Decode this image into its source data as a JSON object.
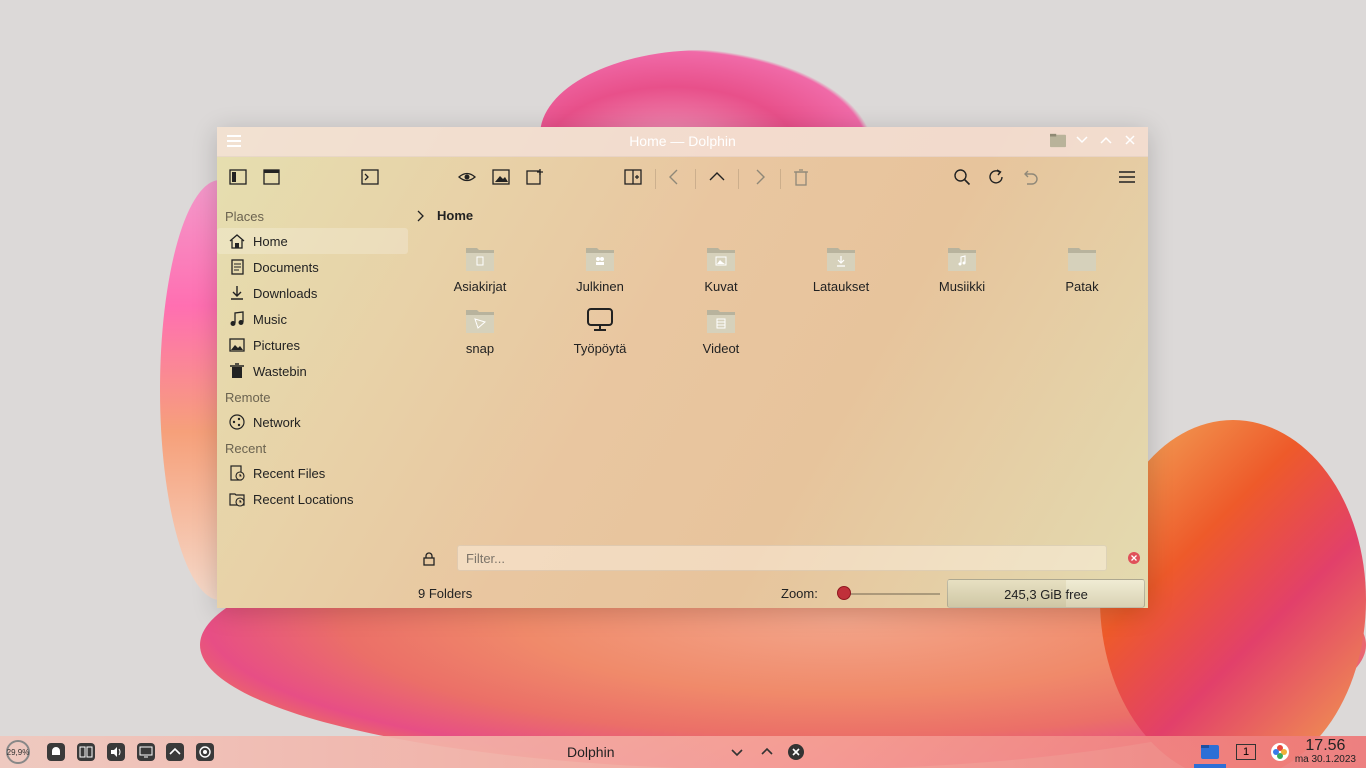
{
  "window": {
    "title": "Home — Dolphin"
  },
  "sidebar": {
    "sections": [
      {
        "title": "Places",
        "items": [
          {
            "label": "Home",
            "icon": "home-icon"
          },
          {
            "label": "Documents",
            "icon": "document-icon"
          },
          {
            "label": "Downloads",
            "icon": "download-icon"
          },
          {
            "label": "Music",
            "icon": "music-icon"
          },
          {
            "label": "Pictures",
            "icon": "picture-icon"
          },
          {
            "label": "Wastebin",
            "icon": "trash-icon"
          }
        ]
      },
      {
        "title": "Remote",
        "items": [
          {
            "label": "Network",
            "icon": "network-icon"
          }
        ]
      },
      {
        "title": "Recent",
        "items": [
          {
            "label": "Recent Files",
            "icon": "recent-files-icon"
          },
          {
            "label": "Recent Locations",
            "icon": "recent-locations-icon"
          }
        ]
      }
    ]
  },
  "breadcrumb": {
    "current": "Home"
  },
  "files": [
    {
      "name": "Asiakirjat",
      "icon": "folder-documents-icon"
    },
    {
      "name": "Julkinen",
      "icon": "folder-public-icon"
    },
    {
      "name": "Kuvat",
      "icon": "folder-pictures-icon"
    },
    {
      "name": "Lataukset",
      "icon": "folder-download-icon"
    },
    {
      "name": "Musiikki",
      "icon": "folder-music-icon"
    },
    {
      "name": "Patak",
      "icon": "folder-icon"
    },
    {
      "name": "snap",
      "icon": "folder-snap-icon"
    },
    {
      "name": "Työpöytä",
      "icon": "desktop-icon"
    },
    {
      "name": "Videot",
      "icon": "folder-videos-icon"
    }
  ],
  "filter": {
    "placeholder": "Filter..."
  },
  "status": {
    "summary": "9 Folders",
    "zoom_label": "Zoom:",
    "free_space": "245,3 GiB free",
    "used_fraction": 0.6
  },
  "taskbar": {
    "cpu": "29,9%",
    "task_title": "Dolphin",
    "desktop_number": "1",
    "time": "17.56",
    "date": "ma 30.1.2023"
  },
  "colors": {
    "accent": "#2d6fd6",
    "slider_knob": "#c0303a"
  }
}
